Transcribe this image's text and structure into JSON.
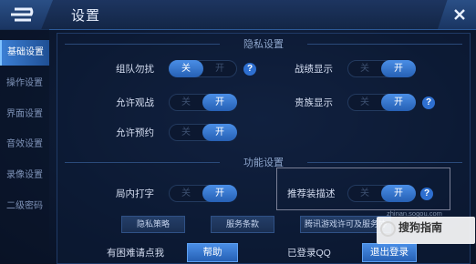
{
  "header": {
    "title": "设置"
  },
  "sidebar": {
    "items": [
      {
        "label": "基础设置",
        "active": true
      },
      {
        "label": "操作设置",
        "active": false
      },
      {
        "label": "界面设置",
        "active": false
      },
      {
        "label": "音效设置",
        "active": false
      },
      {
        "label": "录像设置",
        "active": false
      },
      {
        "label": "二级密码",
        "active": false
      }
    ]
  },
  "privacy": {
    "section_title": "隐私设置",
    "rows": [
      {
        "label": "组队勿扰",
        "off_text": "关",
        "on_text": "开",
        "state": "off",
        "help": "?"
      },
      {
        "label": "战绩显示",
        "off_text": "关",
        "on_text": "开",
        "state": "on"
      },
      {
        "label": "允许观战",
        "off_text": "关",
        "on_text": "开",
        "state": "on"
      },
      {
        "label": "贵族显示",
        "off_text": "关",
        "on_text": "开",
        "state": "on",
        "help": "?"
      },
      {
        "label": "允许预约",
        "off_text": "关",
        "on_text": "开",
        "state": "on"
      }
    ]
  },
  "function": {
    "section_title": "功能设置",
    "rows": [
      {
        "label": "局内打字",
        "off_text": "关",
        "on_text": "开",
        "state": "on"
      },
      {
        "label": "推荐装描述",
        "off_text": "关",
        "on_text": "开",
        "state": "on",
        "help": "?"
      }
    ]
  },
  "links": {
    "privacy_policy": "隐私策略",
    "terms": "服务条款",
    "license": "腾讯游戏许可及服务协"
  },
  "footer": {
    "help_prompt": "有困难请点我",
    "help_button": "帮助",
    "login_status": "已登录QQ",
    "logout_button": "退出登录"
  },
  "watermark": {
    "text": "搜狗指南",
    "url": "zhinan.sogou.com"
  },
  "colors": {
    "accent": "#2e6fd0",
    "toggle_on": "#3a7edc",
    "background": "#0d1a33"
  }
}
